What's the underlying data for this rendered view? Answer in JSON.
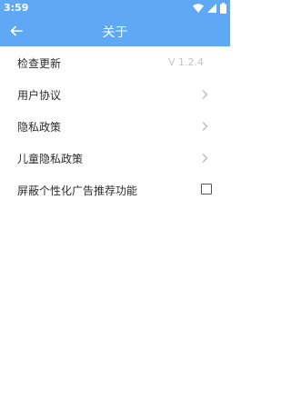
{
  "status_bar": {
    "time": "3:59",
    "icons": [
      "wifi-icon",
      "cellular-signal-icon",
      "battery-icon"
    ]
  },
  "app_bar": {
    "title": "关于",
    "back_icon": "back-arrow-icon"
  },
  "colors": {
    "primary": "#5ea8f5",
    "text": "#2c2c2c",
    "secondary_text": "#c4c4c4"
  },
  "items": [
    {
      "label": "检查更新",
      "value": "V 1.2.4",
      "type": "value"
    },
    {
      "label": "用户协议",
      "type": "chevron"
    },
    {
      "label": "隐私政策",
      "type": "chevron"
    },
    {
      "label": "儿童隐私政策",
      "type": "chevron"
    },
    {
      "label": "屏蔽个性化广告推荐功能",
      "type": "checkbox",
      "checked": false
    }
  ]
}
